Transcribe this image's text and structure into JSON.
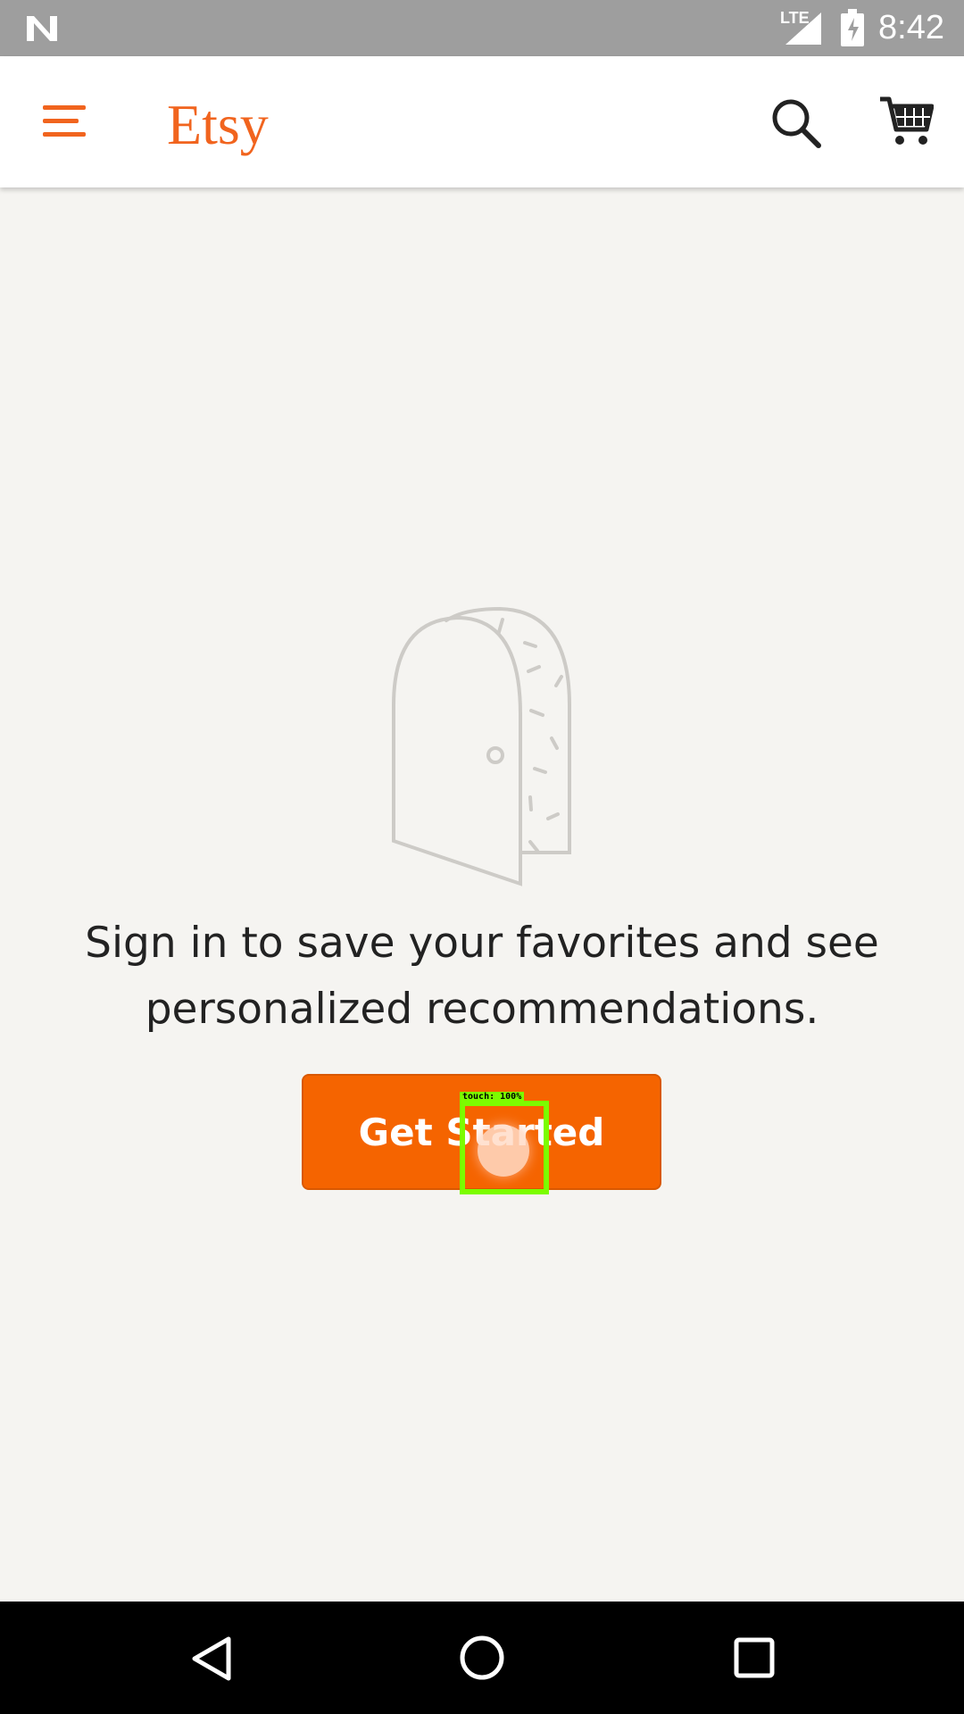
{
  "status_bar": {
    "time": "8:42",
    "network": "LTE",
    "icons": [
      "notification-n-icon",
      "signal-icon",
      "battery-charging-icon"
    ]
  },
  "app_bar": {
    "logo": "Etsy",
    "icons": [
      "menu-icon",
      "search-icon",
      "cart-icon"
    ]
  },
  "main": {
    "message": "Sign in to save your favorites and see personalized recommendations.",
    "button_label": "Get Started",
    "illustration": "open-door-icon"
  },
  "overlay": {
    "touch_label": "touch: 100%"
  },
  "colors": {
    "brand": "#f1641e",
    "button": "#f56400"
  },
  "nav_bar": {
    "icons": [
      "back-icon",
      "home-icon",
      "recents-icon"
    ]
  }
}
